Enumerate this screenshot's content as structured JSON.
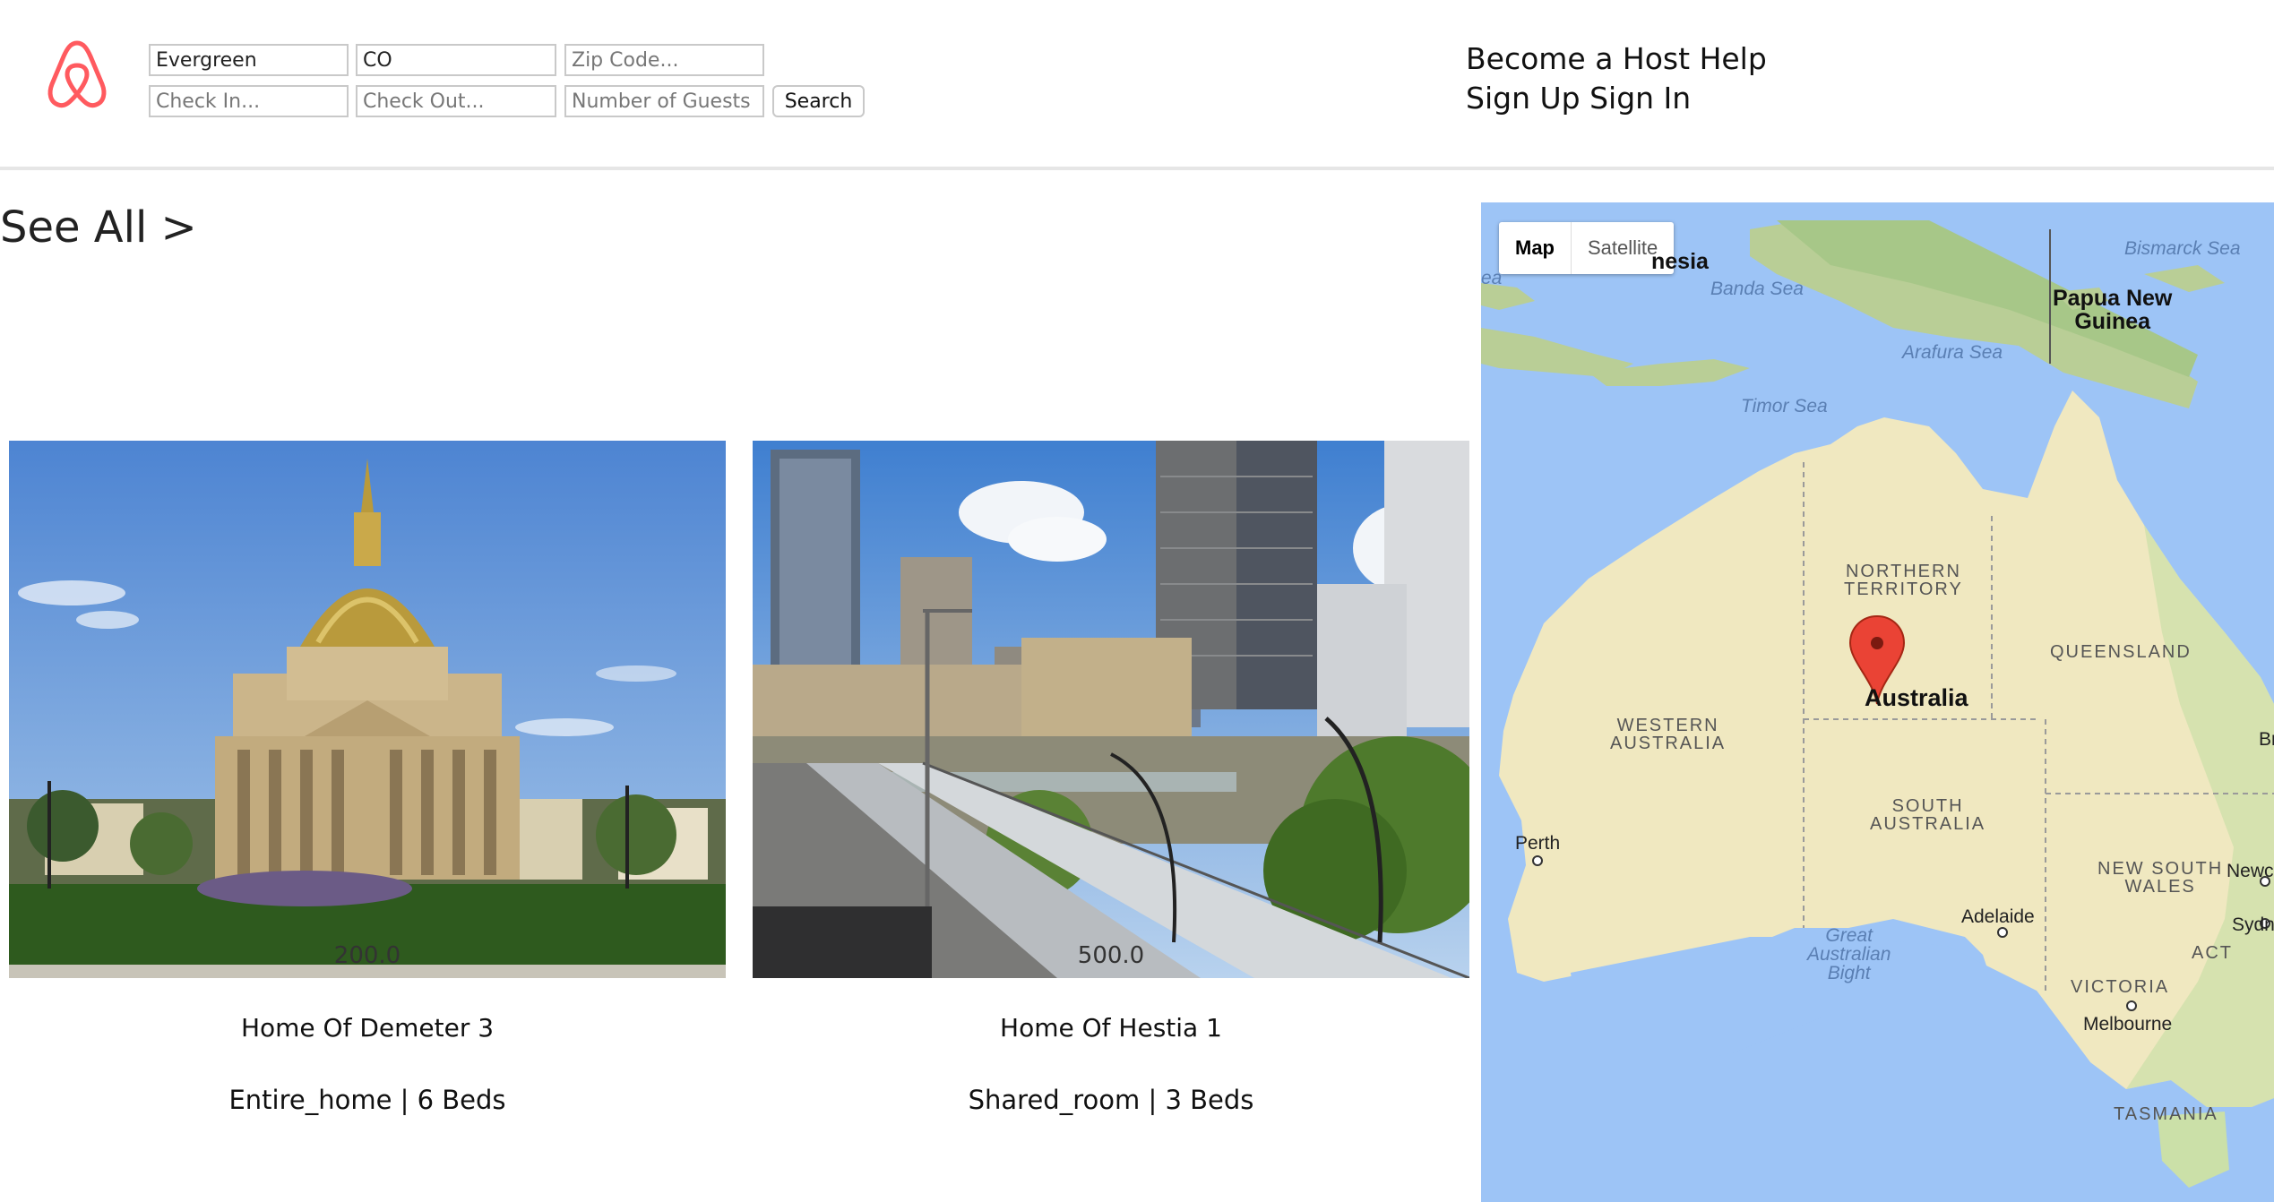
{
  "search": {
    "city_value": "Evergreen",
    "state_value": "CO",
    "zip_placeholder": "Zip Code...",
    "checkin_placeholder": "Check In...",
    "checkout_placeholder": "Check Out...",
    "guests_placeholder": "Number of Guests",
    "search_label": "Search"
  },
  "nav": {
    "become_host": "Become a Host",
    "help": "Help",
    "sign_up": "Sign Up",
    "sign_in": "Sign In"
  },
  "see_all": "See All >",
  "listings": [
    {
      "price": "200.0",
      "title": "Home Of Demeter 3",
      "meta": "Entire_home | 6 Beds"
    },
    {
      "price": "500.0",
      "title": "Home Of Hestia 1",
      "meta": "Shared_room | 3 Beds"
    }
  ],
  "map": {
    "type_map": "Map",
    "type_satellite": "Satellite",
    "labels": {
      "indonesia": "nesia",
      "banda_sea": "Banda Sea",
      "bismarck_sea": "Bismarck Sea",
      "png_line1": "Papua New",
      "png_line2": "Guinea",
      "arafura_sea": "Arafura Sea",
      "timor_sea": "Timor Sea",
      "left_edge_sea": "ea",
      "nt_line1": "NORTHERN",
      "nt_line2": "TERRITORY",
      "queensland": "QUEENSLAND",
      "australia": "Australia",
      "wa_line1": "WESTERN",
      "wa_line2": "AUSTRALIA",
      "sa_line1": "SOUTH",
      "sa_line2": "AUSTRALIA",
      "perth": "Perth",
      "nsw_line1": "NEW SOUTH",
      "nsw_line2": "WALES",
      "newcastle": "Newc",
      "sydney": "Sydn",
      "adelaide": "Adelaide",
      "act": "ACT",
      "gab_line1": "Great",
      "gab_line2": "Australian",
      "gab_line3": "Bight",
      "victoria": "VICTORIA",
      "melbourne": "Melbourne",
      "tasmania": "TASMANIA",
      "brisbane_partial": "Br"
    }
  },
  "colors": {
    "brand": "#ff5a5f",
    "water": "#9dc4f6",
    "land": "#f0e8c0",
    "marker": "#ea4335"
  }
}
